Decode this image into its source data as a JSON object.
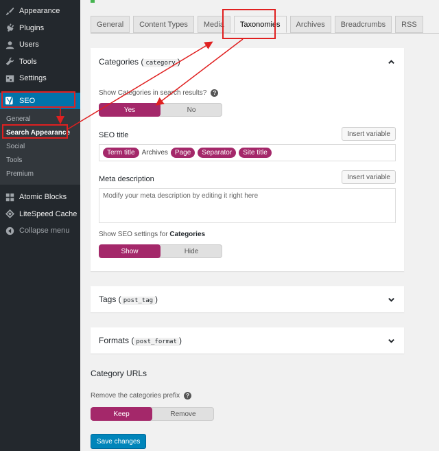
{
  "sidebar": {
    "items_top": [
      {
        "label": "Appearance",
        "icon": "paintbrush-icon"
      },
      {
        "label": "Plugins",
        "icon": "plug-icon"
      },
      {
        "label": "Users",
        "icon": "user-icon"
      },
      {
        "label": "Tools",
        "icon": "wrench-icon"
      },
      {
        "label": "Settings",
        "icon": "settings-icon"
      }
    ],
    "seo": {
      "label": "SEO",
      "icon": "yoast-icon"
    },
    "submenu": [
      "General",
      "Search Appearance",
      "Social",
      "Tools",
      "Premium"
    ],
    "items_bottom": [
      {
        "label": "Atomic Blocks",
        "icon": "grid-icon"
      },
      {
        "label": "LiteSpeed Cache",
        "icon": "diamond-icon"
      }
    ],
    "collapse": "Collapse menu"
  },
  "tabs": [
    "General",
    "Content Types",
    "Media",
    "Taxonomies",
    "Archives",
    "Breadcrumbs",
    "RSS"
  ],
  "categories_panel": {
    "title": "Categories (",
    "code": "category",
    "title_end": ")",
    "show_question": "Show Categories in search results?",
    "toggle_yes": "Yes",
    "toggle_no": "No",
    "seo_title_label": "SEO title",
    "insert_variable": "Insert variable",
    "title_pills": [
      "Term title",
      "Archives",
      "Page",
      "Separator",
      "Site title"
    ],
    "meta_label": "Meta description",
    "meta_placeholder": "Modify your meta description by editing it right here",
    "show_settings_prefix": "Show SEO settings for ",
    "show_settings_bold": "Categories",
    "toggle_show": "Show",
    "toggle_hide": "Hide"
  },
  "tags_panel": {
    "title": "Tags (",
    "code": "post_tag",
    "title_end": ")"
  },
  "formats_panel": {
    "title": "Formats (",
    "code": "post_format",
    "title_end": ")"
  },
  "category_urls": {
    "heading": "Category URLs",
    "remove_prefix": "Remove the categories prefix",
    "toggle_keep": "Keep",
    "toggle_remove": "Remove"
  },
  "save_button": "Save changes",
  "colors": {
    "accent": "#a4286a",
    "primary": "#0085ba",
    "sidebar": "#23282d",
    "highlight": "#e02020"
  }
}
